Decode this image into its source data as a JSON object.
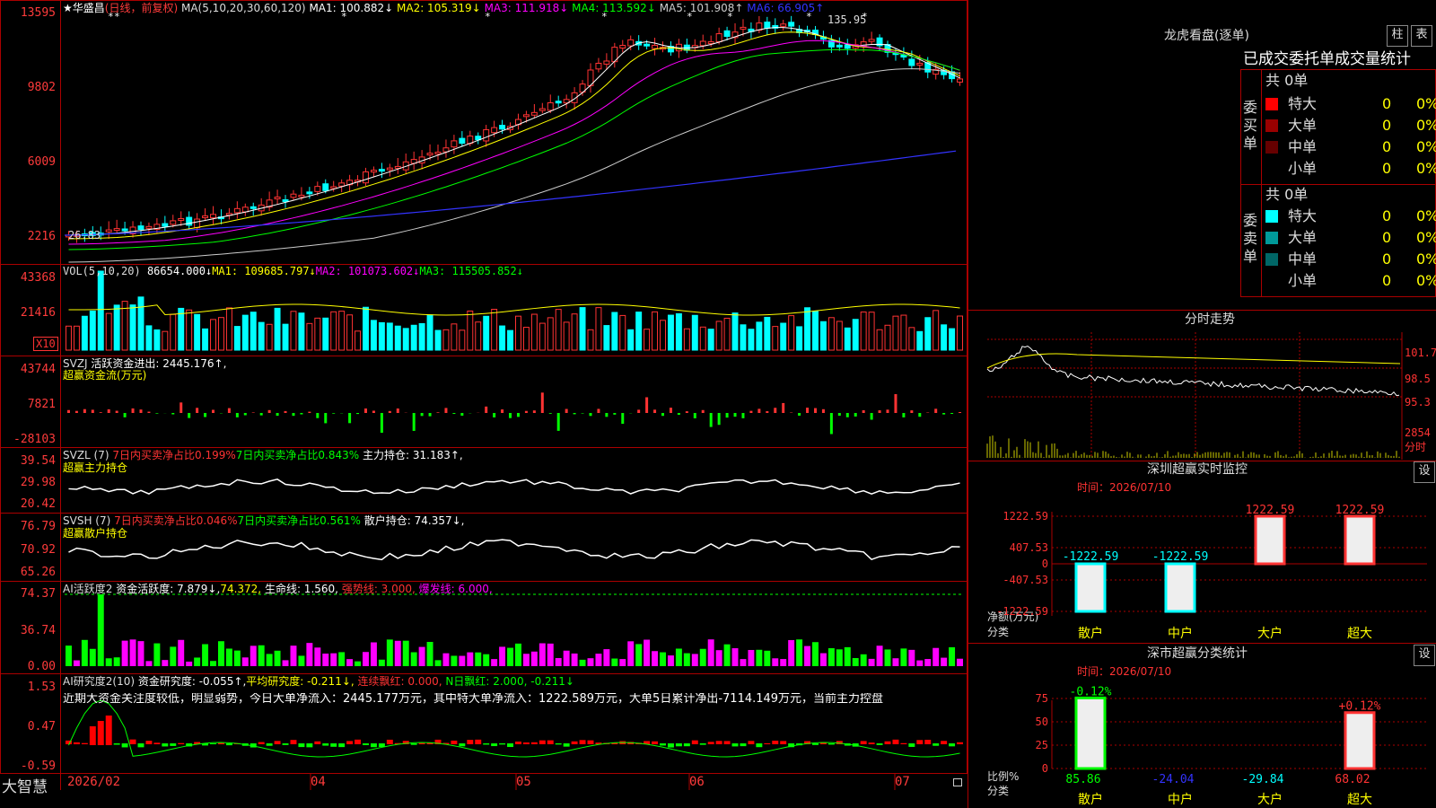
{
  "app_name": "大智慧",
  "colors": {
    "up": "#ff3333",
    "down": "#00ffff",
    "bg": "#000000",
    "grid": "#aa0000",
    "ma1": "#ffffff",
    "ma2": "#ffff00",
    "ma3": "#ff00ff",
    "ma4": "#00ff00",
    "ma5": "#c0c0c0",
    "ma6": "#3030ff"
  },
  "main_chart": {
    "star": "★",
    "stock_name": "华盛昌",
    "period": "(日线，前复权)",
    "ma_label": "MA(5,10,20,30,60,120)",
    "ma_values": [
      "MA1: 100.882↓",
      "MA2: 105.319↓",
      "MA3: 111.918↓",
      "MA4: 113.592↓",
      "MA5: 101.908↑",
      "MA6: 66.905↑"
    ],
    "y_ticks": [
      "13595",
      "9802",
      "6009",
      "2216"
    ],
    "high_label": "135.95",
    "low_label": "26.83"
  },
  "vol_panel": {
    "title": "VOL(5,10,20)",
    "val": "86654.000↓",
    "ma1": "MA1: 109685.797↓",
    "ma2": "MA2: 101073.602↓",
    "ma3": "MA3: 115505.852↓",
    "y_ticks": [
      "43368",
      "21416"
    ],
    "scale": "X10"
  },
  "svzj_panel": {
    "title": "SVZJ",
    "metric": "活跃资金进出: 2445.176↑,",
    "subtitle": "超赢资金流(万元)",
    "y_ticks": [
      "43744",
      "7821",
      "-28103"
    ]
  },
  "svzl_panel": {
    "title": "SVZL (7)",
    "m1": "7日内买卖净占比0.199%",
    "m2": "7日内买卖净占比0.843%",
    "m3": "主力持仓: 31.183↑,",
    "subtitle": "超赢主力持仓",
    "y_ticks": [
      "39.54",
      "29.98",
      "20.42"
    ]
  },
  "svsh_panel": {
    "title": "SVSH (7)",
    "m1": "7日内买卖净占比0.046%",
    "m2": "7日内买卖净占比0.561%",
    "m3": "散户持仓: 74.357↓,",
    "subtitle": "超赢散户持仓",
    "y_ticks": [
      "76.79",
      "70.92",
      "65.26"
    ]
  },
  "ai_active": {
    "title": "AI活跃度2",
    "m1": "资金活跃度: 7.879↓,",
    "m2": "74.372,",
    "m3": "生命线: 1.560,",
    "m4": "强势线: 3.000,",
    "m5": "爆发线: 6.000,",
    "y_ticks": [
      "74.37",
      "36.74",
      "0.00"
    ]
  },
  "ai_research": {
    "title": "AI研究度2(10)",
    "m1": "资金研究度: -0.055↑,",
    "m2": "平均研究度: -0.211↓,",
    "m3": "连续飘红: 0.000,",
    "m4": "N日飘红: 2.000,",
    "m5": "-0.211↓",
    "commentary": "近期大资金关注度较低，明显弱势，今日大单净流入：2445.177万元，其中特大单净流入：1222.589万元，大单5日累计净出-7114.149万元，当前主力控盘",
    "y_ticks": [
      "1.53",
      "0.47",
      "-0.59"
    ]
  },
  "x_axis": [
    "2026/02",
    "04",
    "05",
    "06",
    "07"
  ],
  "right": {
    "lhb_title": "龙虎看盘(逐单)",
    "btn_zhu": "柱",
    "btn_biao": "表",
    "tab_header": "已成交委托单成交量统计",
    "buy_side": "委买单",
    "sell_side": "委卖单",
    "buy_total": "共 0单",
    "sell_total": "共 0单",
    "buy_rows": [
      {
        "label": "特大",
        "count": "0",
        "pct": "0%",
        "color": "#ff0000"
      },
      {
        "label": "大单",
        "count": "0",
        "pct": "0%",
        "color": "#990000"
      },
      {
        "label": "中单",
        "count": "0",
        "pct": "0%",
        "color": "#660000"
      },
      {
        "label": "小单",
        "count": "0",
        "pct": "0%",
        "color": "#000000"
      }
    ],
    "sell_rows": [
      {
        "label": "特大",
        "count": "0",
        "pct": "0%",
        "color": "#00ffff"
      },
      {
        "label": "大单",
        "count": "0",
        "pct": "0%",
        "color": "#009999"
      },
      {
        "label": "中单",
        "count": "0",
        "pct": "0%",
        "color": "#006666"
      },
      {
        "label": "小单",
        "count": "0",
        "pct": "0%",
        "color": "#000000"
      }
    ],
    "intraday_title": "分时走势",
    "intraday_ticks": [
      "101.7",
      "98.5",
      "95.3",
      "2854",
      "分时"
    ],
    "sz_monitor_title": "深圳超赢实时监控",
    "sz_monitor_btn": "设",
    "sz_monitor_time": "时间：2026/07/10",
    "sz_monitor_yticks": [
      "1222.59",
      "407.53",
      "0",
      "-407.53",
      "-1222.59"
    ],
    "sz_monitor_ylabel": "净额(万元)",
    "sz_monitor_xlabel": "分类",
    "sz_monitor_bars": [
      {
        "cat": "散户",
        "value": -1222.59,
        "label": "-1222.59"
      },
      {
        "cat": "中户",
        "value": -1222.59,
        "label": "-1222.59"
      },
      {
        "cat": "大户",
        "value": 1222.59,
        "label": "1222.59"
      },
      {
        "cat": "超大",
        "value": 1222.59,
        "label": "1222.59"
      }
    ],
    "class_title": "深市超赢分类统计",
    "class_btn": "设",
    "class_time": "时间：2026/07/10",
    "class_yticks": [
      "75",
      "50",
      "25",
      "0"
    ],
    "class_ylabel": "比例%",
    "class_xlabel": "分类",
    "class_bars": [
      {
        "cat": "散户",
        "value": 85.86,
        "label": "85.86",
        "top_label": "-0.12%"
      },
      {
        "cat": "中户",
        "value": -24.04,
        "label": "-24.04",
        "top_label": ""
      },
      {
        "cat": "大户",
        "value": -29.84,
        "label": "-29.84",
        "top_label": ""
      },
      {
        "cat": "超大",
        "value": 68.02,
        "label": "68.02",
        "top_label": "+0.12%"
      }
    ]
  }
}
